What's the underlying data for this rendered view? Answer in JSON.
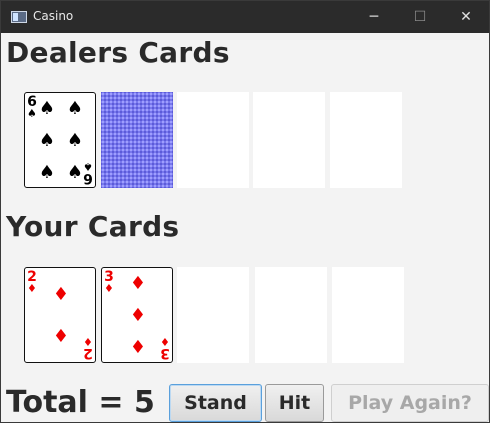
{
  "window": {
    "title": "Casino",
    "min_symbol": "─",
    "max_symbol": "☐",
    "close_symbol": "✕"
  },
  "dealer": {
    "heading": "Dealers Cards",
    "card1": {
      "rank": "6",
      "suit": "♠",
      "color": "#000000"
    }
  },
  "player": {
    "heading": "Your Cards",
    "card1": {
      "rank": "2",
      "suit": "♦",
      "color": "#ee0000"
    },
    "card2": {
      "rank": "3",
      "suit": "♦",
      "color": "#ee0000"
    }
  },
  "footer": {
    "total_label": "Total = 5",
    "stand_label": "Stand",
    "hit_label": "Hit",
    "play_again_label": "Play Again?"
  },
  "icons": [
    "app-icon",
    "minimize-icon",
    "maximize-icon",
    "close-icon",
    "card-back"
  ]
}
